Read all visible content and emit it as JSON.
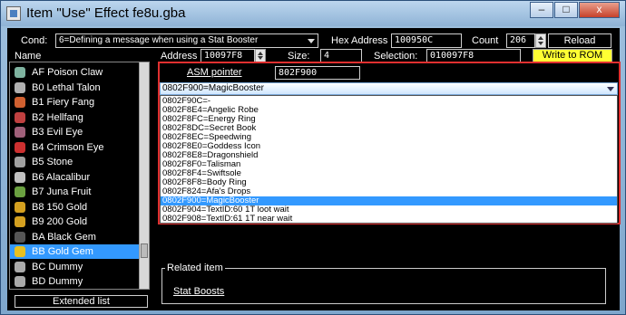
{
  "window": {
    "title": "Item \"Use\" Effect fe8u.gba",
    "controls": [
      "–",
      "□",
      "x"
    ]
  },
  "toolbar": {
    "cond_label": "Cond:",
    "cond_value": "6=Defining a message when using a Stat Booster",
    "hex_label": "Hex Address",
    "hex_value": "100950C",
    "count_label": "Count",
    "count_value": "206",
    "reload_label": "Reload"
  },
  "row2": {
    "name_label": "Name",
    "address_label": "Address",
    "address_value": "10097F8",
    "size_label": "Size:",
    "size_value": "4",
    "selection_label": "Selection:",
    "selection_value": "010097F8",
    "write_label": "Write to ROM"
  },
  "item_list": {
    "items": [
      {
        "label": "AF Poison Claw",
        "icon": "claw-icon",
        "color": "#7fb3a0"
      },
      {
        "label": "B0 Lethal Talon",
        "icon": "talon-icon",
        "color": "#b0b0b0"
      },
      {
        "label": "B1 Fiery Fang",
        "icon": "fang-icon",
        "color": "#d06030"
      },
      {
        "label": "B2 Hellfang",
        "icon": "fang-icon",
        "color": "#c04040"
      },
      {
        "label": "B3 Evil Eye",
        "icon": "eye-icon",
        "color": "#a0607a"
      },
      {
        "label": "B4 Crimson Eye",
        "icon": "eye-icon",
        "color": "#cc3030"
      },
      {
        "label": "B5 Stone",
        "icon": "stone-icon",
        "color": "#a0a0a0"
      },
      {
        "label": "B6 Alacalibur",
        "icon": "sword-icon",
        "color": "#c0c0c0"
      },
      {
        "label": "B7 Juna Fruit",
        "icon": "fruit-icon",
        "color": "#6aa040"
      },
      {
        "label": "B8 150 Gold",
        "icon": "gold-bag-icon",
        "color": "#d4a020"
      },
      {
        "label": "B9 200 Gold",
        "icon": "gold-bag-icon",
        "color": "#d4a020"
      },
      {
        "label": "BA Black Gem",
        "icon": "gem-icon",
        "color": "#555555"
      },
      {
        "label": "BB Gold Gem",
        "icon": "gem-icon",
        "color": "#e8c020"
      },
      {
        "label": "BC Dummy",
        "icon": "dummy-icon",
        "color": "#aaaaaa"
      },
      {
        "label": "BD Dummy",
        "icon": "dummy-icon",
        "color": "#aaaaaa"
      }
    ],
    "selected_index": 12,
    "extended_label": "Extended list"
  },
  "asm": {
    "pointer_label": "ASM pointer",
    "pointer_value": "802F900",
    "combo_value": "0802F900=MagicBooster",
    "options": [
      "0802F90C=-",
      "0802F8E4=Angelic Robe",
      "0802F8FC=Energy Ring",
      "0802F8DC=Secret Book",
      "0802F8EC=Speedwing",
      "0802F8E0=Goddess Icon",
      "0802F8E8=Dragonshield",
      "0802F8F0=Talisman",
      "0802F8F4=Swiftsole",
      "0802F8F8=Body Ring",
      "0802F824=Afa's Drops",
      "0802F900=MagicBooster",
      "0802F904=TextID:60 1T loot wait",
      "0802F908=TextID:61 1T near wait"
    ],
    "selected_option": 11
  },
  "related": {
    "legend": "Related item",
    "link": "Stat Boosts"
  },
  "colors": {
    "accent_selection": "#3399ff",
    "highlight_frame": "#e03030",
    "write_button": "#ffff33"
  }
}
